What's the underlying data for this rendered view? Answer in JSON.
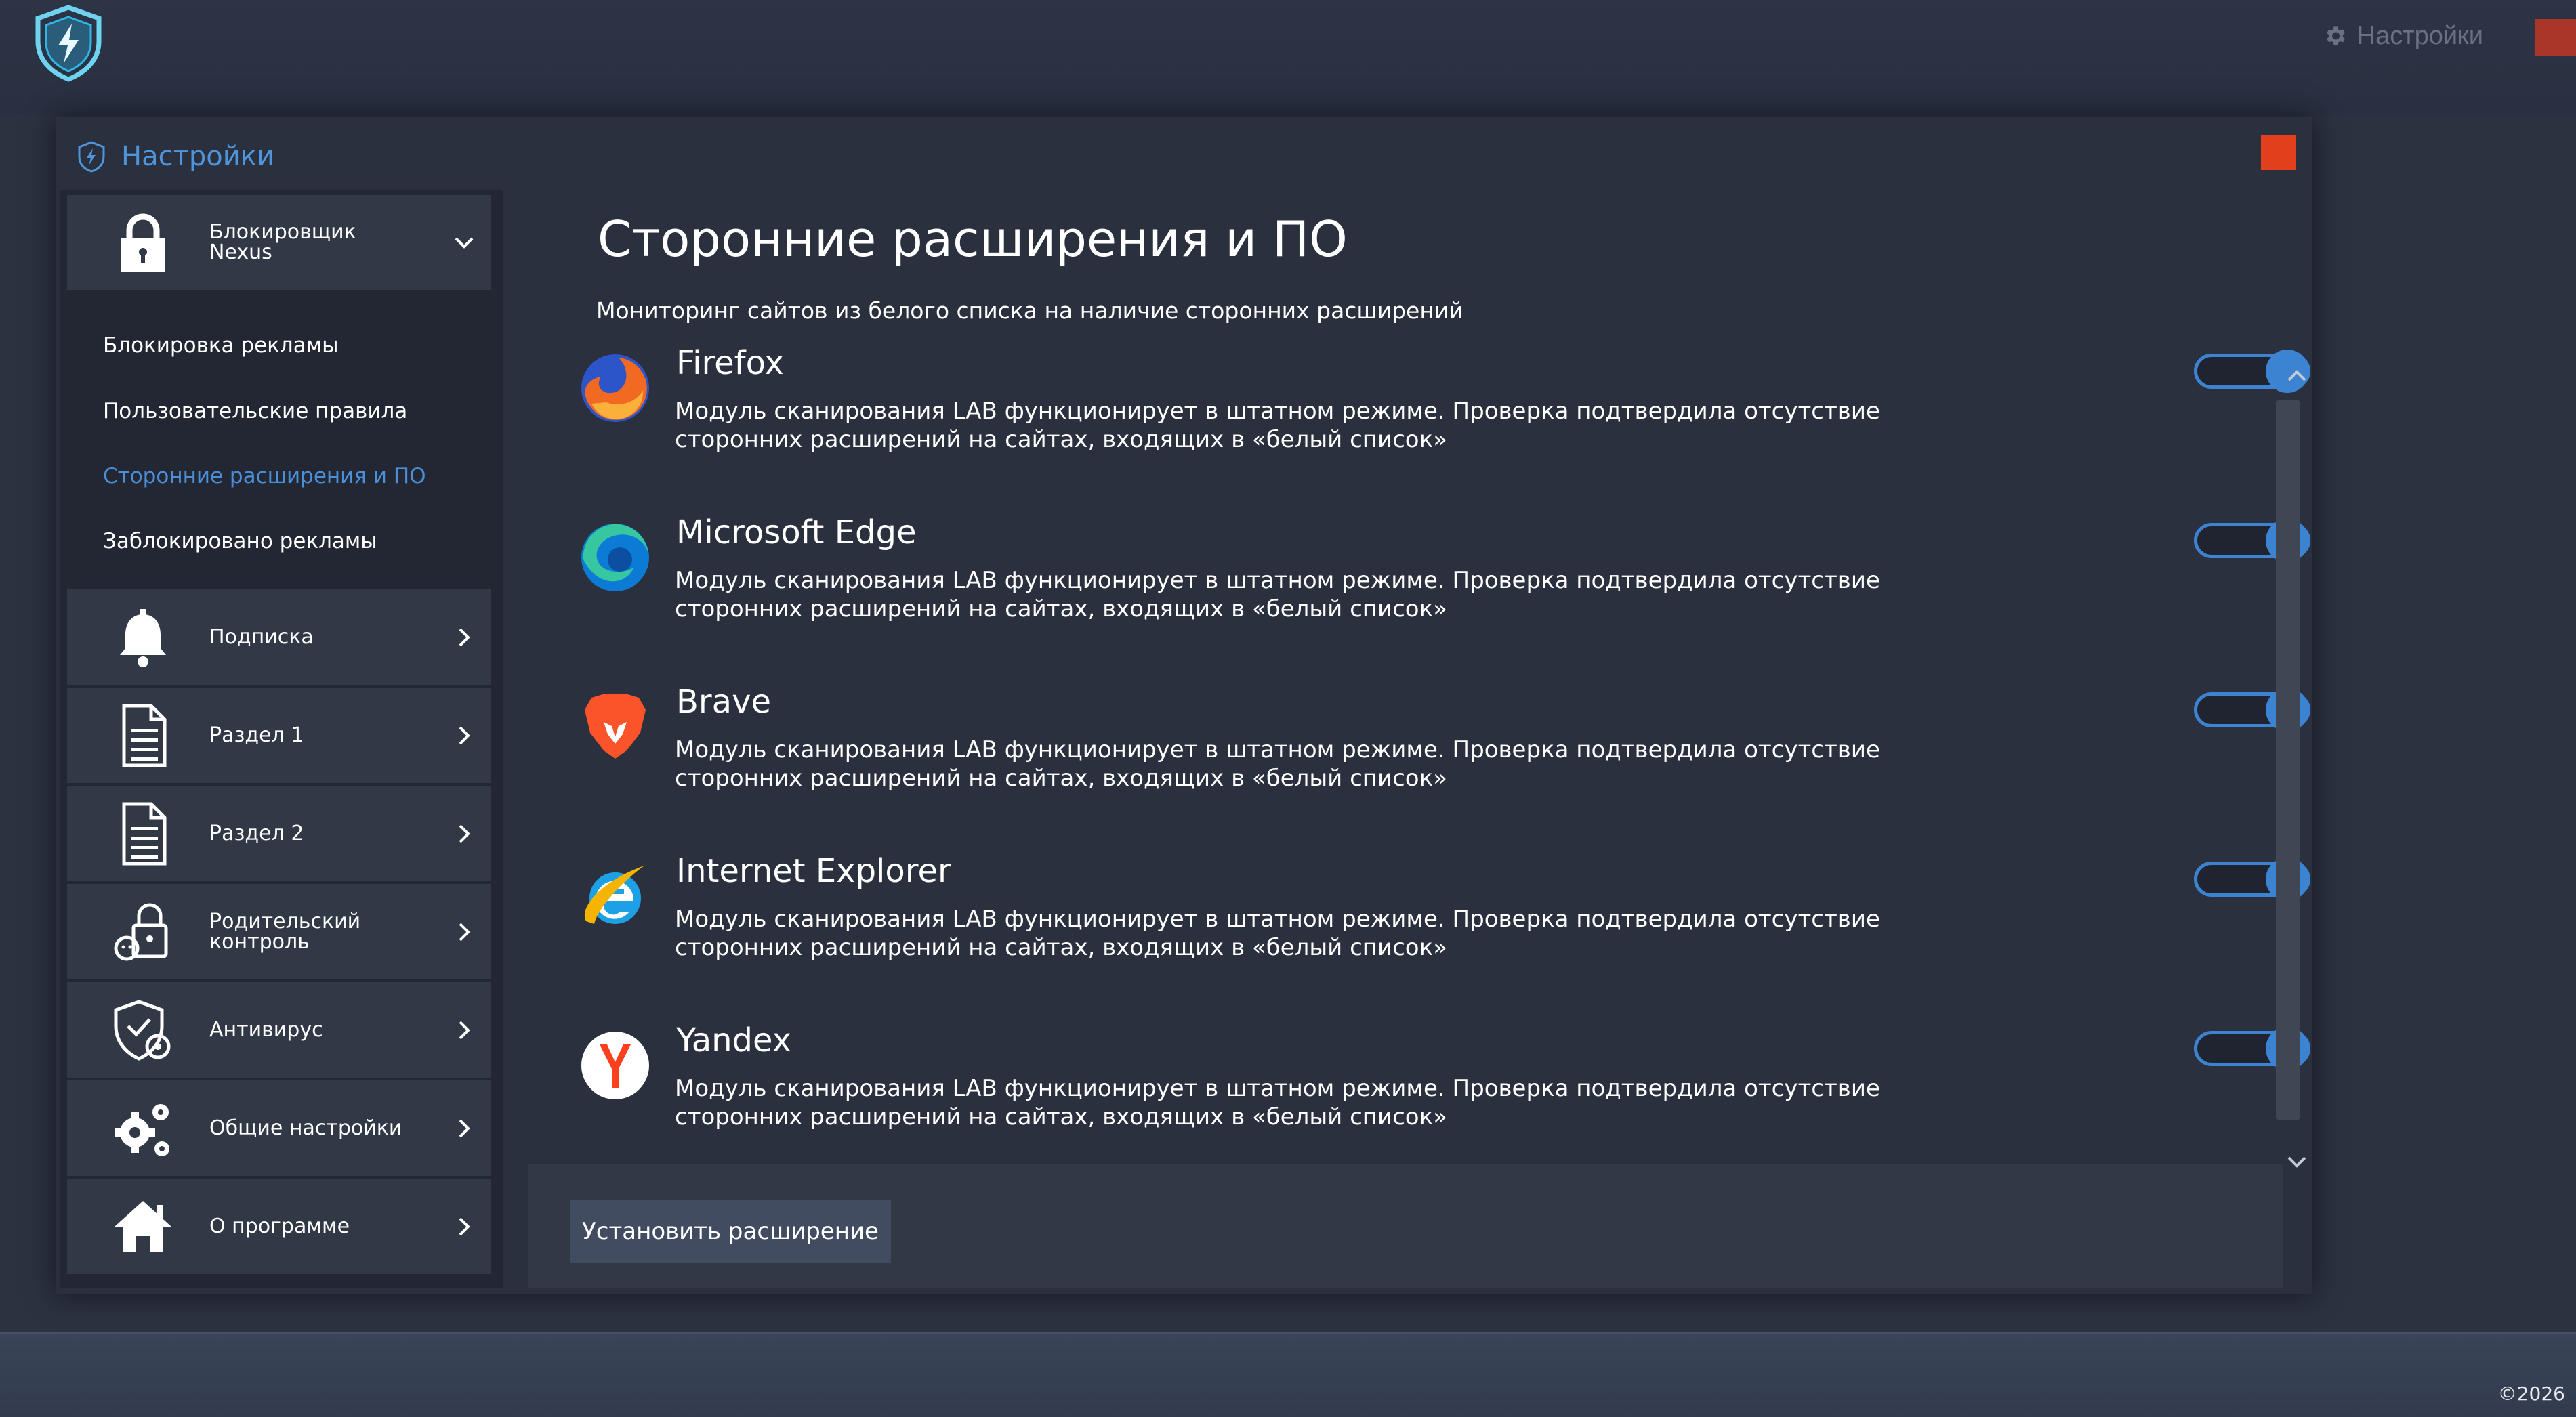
{
  "top": {
    "settings_label": "Настройки"
  },
  "dialog": {
    "title": "Настройки"
  },
  "sidebar": {
    "header": {
      "label": "Блокировщик\nNexus"
    },
    "subitems": [
      {
        "label": "Блокировка рекламы"
      },
      {
        "label": "Пользовательские правила"
      },
      {
        "label": "Сторонние расширения и ПО"
      },
      {
        "label": "Заблокировано рекламы"
      }
    ],
    "items": [
      {
        "label": "Подписка",
        "icon": "bell-icon"
      },
      {
        "label": "Раздел 1",
        "icon": "document-icon"
      },
      {
        "label": "Раздел 2",
        "icon": "document-icon"
      },
      {
        "label": "Родительский\nконтроль",
        "icon": "parental-lock-icon"
      },
      {
        "label": "Антивирус",
        "icon": "shield-gear-icon"
      },
      {
        "label": "Общие настройки",
        "icon": "gears-icon"
      },
      {
        "label": "О программе",
        "icon": "home-icon"
      }
    ]
  },
  "main": {
    "title": "Сторонние расширения и ПО",
    "subtitle": "Мониторинг сайтов из белого списка на наличие сторонних расширений",
    "browsers": [
      {
        "name": "Firefox",
        "description": "Модуль сканирования LAB функционирует в штатном режиме. Проверка подтвердила отсутствие сторонних расширений на сайтах, входящих в «белый список»",
        "enabled": true
      },
      {
        "name": "Microsoft Edge",
        "description": "Модуль сканирования LAB функционирует в штатном режиме. Проверка подтвердила отсутствие сторонних расширений на сайтах, входящих в «белый список»",
        "enabled": true
      },
      {
        "name": "Brave",
        "description": "Модуль сканирования LAB функционирует в штатном режиме. Проверка подтвердила отсутствие сторонних расширений на сайтах, входящих в «белый список»",
        "enabled": true
      },
      {
        "name": "Internet Explorer",
        "description": "Модуль сканирования LAB функционирует в штатном режиме. Проверка подтвердила отсутствие сторонних расширений на сайтах, входящих в «белый список»",
        "enabled": true
      },
      {
        "name": "Yandex",
        "description": "Модуль сканирования LAB функционирует в штатном режиме. Проверка подтвердила отсутствие сторонних расширений на сайтах, входящих в «белый список»",
        "enabled": true
      }
    ],
    "install_button": "Установить расширение"
  },
  "footer": {
    "copyright": "©2026"
  },
  "colors": {
    "accent": "#3c83d1",
    "close": "#e2401d",
    "background": "#2a303d"
  }
}
